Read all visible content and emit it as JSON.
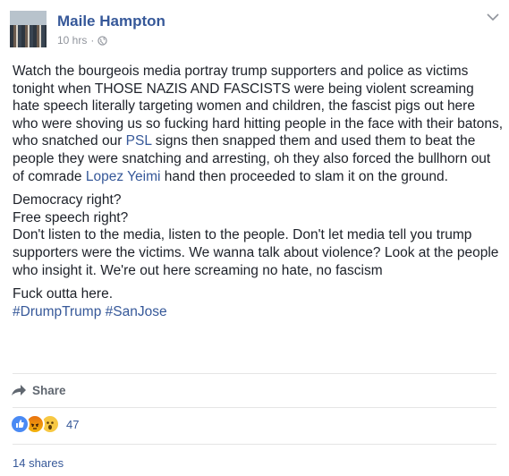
{
  "post": {
    "author": "Maile Hampton",
    "time": "10 hrs",
    "separator": "·",
    "paragraphs": [
      [
        {
          "text": "Watch the bourgeois media portray trump supporters and police as victims tonight when THOSE NAZIS AND FASCISTS were being violent screaming hate speech literally targeting women and children, the fascist pigs out here who were shoving us so fucking hard hitting people in the face with their batons, who snatched our ",
          "link": false
        },
        {
          "text": "PSL",
          "link": true
        },
        {
          "text": " signs then snapped them and used them to beat the people they were snatching and arresting, oh they also forced the bullhorn out of comrade ",
          "link": false
        },
        {
          "text": "Lopez Yeimi",
          "link": true
        },
        {
          "text": " hand then proceeded to slam it on the ground.",
          "link": false
        }
      ],
      [
        {
          "text": "Democracy right?",
          "link": false,
          "br": true
        },
        {
          "text": "Free speech right?",
          "link": false,
          "br": true
        },
        {
          "text": "Don't listen to the media, listen to the people. Don't let media tell you trump supporters were the victims. We wanna talk about violence? Look at the people who insight it. We're out here screaming no hate, no fascism",
          "link": false
        }
      ],
      [
        {
          "text": "Fuck outta here.",
          "link": false,
          "br": true
        },
        {
          "text": "#DrumpTrump",
          "link": true
        },
        {
          "text": " ",
          "link": false
        },
        {
          "text": "#SanJose",
          "link": true
        }
      ]
    ]
  },
  "actions": {
    "share_label": "Share"
  },
  "reactions": {
    "count": "47",
    "types": [
      "like",
      "angry",
      "wow"
    ]
  },
  "footer": {
    "shares": "14 shares"
  },
  "icons": {
    "globe": "globe-icon",
    "menu": "chevron-down-icon",
    "share": "share-arrow-icon"
  },
  "colors": {
    "link": "#365899",
    "meta": "#90949c",
    "text": "#1d2129"
  }
}
